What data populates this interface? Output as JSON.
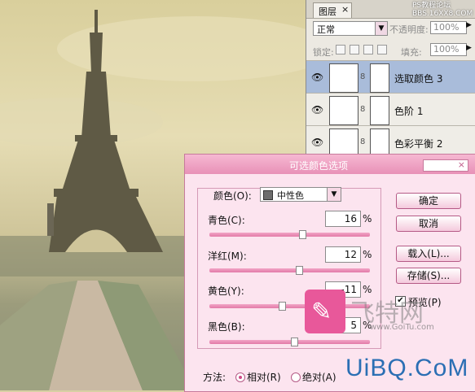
{
  "layers_panel": {
    "tab_label": "图层",
    "tab_close": "×",
    "watermark_top": [
      "PS教程论坛",
      "BBS.16XX8.COM"
    ],
    "blend_mode": "正常",
    "opacity_label": "不透明度:",
    "opacity_value": "100%",
    "lock_label": "锁定:",
    "fill_label": "填充:",
    "fill_value": "100%",
    "layers": [
      {
        "name": "选取颜色 3",
        "selected": true
      },
      {
        "name": "色阶 1",
        "selected": false
      },
      {
        "name": "色彩平衡 2",
        "selected": false
      }
    ]
  },
  "dialog": {
    "title": "可选颜色选项",
    "colors_label": "颜色(O):",
    "colors_value": "中性色",
    "sliders": [
      {
        "label": "青色(C):",
        "value": "16",
        "fraction": 0.58
      },
      {
        "label": "洋红(M):",
        "value": "12",
        "fraction": 0.56
      },
      {
        "label": "黄色(Y):",
        "value": "-11",
        "fraction": 0.45
      },
      {
        "label": "黑色(B):",
        "value": "5",
        "fraction": 0.53
      }
    ],
    "percent": "%",
    "buttons": {
      "ok": "确定",
      "cancel": "取消",
      "load": "载入(L)...",
      "save": "存储(S)..."
    },
    "preview_label": "预览(P)",
    "method_label": "方法:",
    "relative_label": "相对(R)",
    "absolute_label": "绝对(A)",
    "method_selected": "relative"
  },
  "watermarks": {
    "cn": "飞特网",
    "site": "www.GoiTu.com",
    "uibq": "UiBQ.CoM"
  },
  "colors": {
    "accent_pink": "#e891b7",
    "uibq_blue": "#2b6fb4"
  }
}
